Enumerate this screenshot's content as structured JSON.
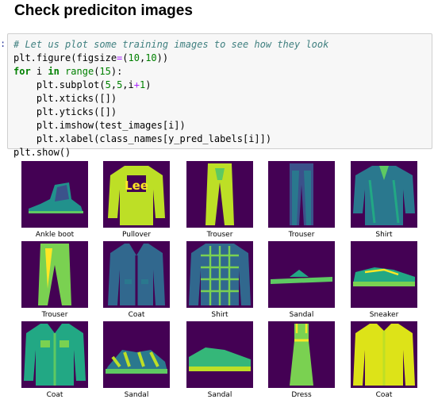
{
  "heading": "Check prediciton images",
  "prompt": ":",
  "code": {
    "line1": "# Let us plot some training images to see how they look",
    "line2": "plt.figure(figsize=(10,10))",
    "line3": "for i in range(15):",
    "line4": "    plt.subplot(5,5,i+1)",
    "line5": "    plt.xticks([])",
    "line6": "    plt.yticks([])",
    "line7": "    plt.imshow(test_images[i])",
    "line8": "    plt.xlabel(class_names[y_pred_labels[i]])",
    "line9": "plt.show()"
  },
  "images": [
    {
      "label": "Ankle boot",
      "icon": "ankle-boot-icon"
    },
    {
      "label": "Pullover",
      "icon": "pullover-icon",
      "print": "Lee"
    },
    {
      "label": "Trouser",
      "icon": "trouser-icon"
    },
    {
      "label": "Trouser",
      "icon": "trouser-icon"
    },
    {
      "label": "Shirt",
      "icon": "shirt-icon"
    },
    {
      "label": "Trouser",
      "icon": "trouser-icon"
    },
    {
      "label": "Coat",
      "icon": "coat-icon"
    },
    {
      "label": "Shirt",
      "icon": "plaid-shirt-icon"
    },
    {
      "label": "Sandal",
      "icon": "sandal-icon"
    },
    {
      "label": "Sneaker",
      "icon": "sneaker-icon"
    },
    {
      "label": "Coat",
      "icon": "coat-icon"
    },
    {
      "label": "Sandal",
      "icon": "sandal-icon"
    },
    {
      "label": "Sandal",
      "icon": "shoe-icon"
    },
    {
      "label": "Dress",
      "icon": "dress-icon"
    },
    {
      "label": "Coat",
      "icon": "coat-icon"
    }
  ],
  "colors": {
    "bg": "#440154",
    "mid": "#21918c",
    "light": "#5ec962",
    "hi": "#fde725"
  }
}
